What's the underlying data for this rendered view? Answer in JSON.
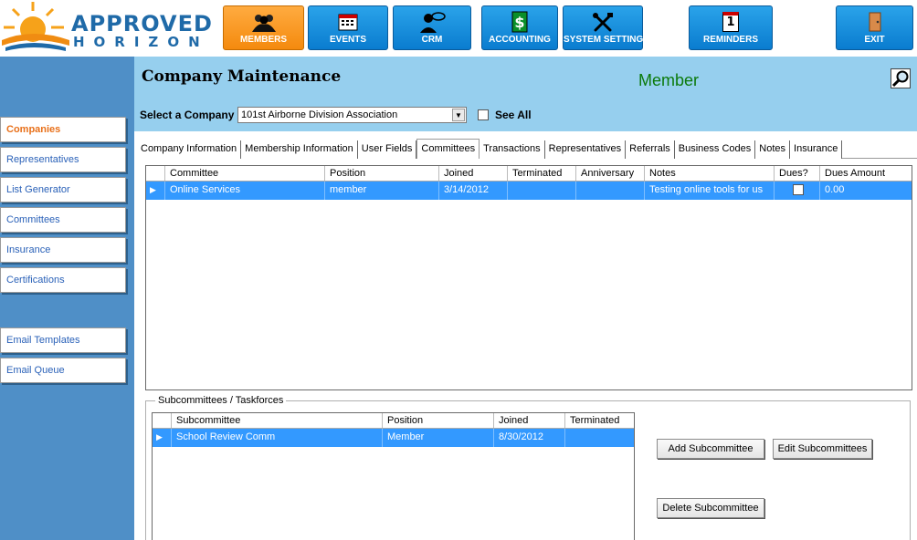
{
  "logo": {
    "line1": "APPROVED",
    "line2": "HORIZON"
  },
  "nav": {
    "members": "MEMBERS",
    "events": "EVENTS",
    "crm": "CRM",
    "accounting": "ACCOUNTING",
    "system_settings": "SYSTEM SETTINGS",
    "reminders": "REMINDERS",
    "reminders_count": "1",
    "exit": "EXIT"
  },
  "sidebar": {
    "items": [
      {
        "label": "Companies"
      },
      {
        "label": "Representatives"
      },
      {
        "label": "List Generator"
      },
      {
        "label": "Committees"
      },
      {
        "label": "Insurance"
      },
      {
        "label": "Certifications"
      },
      {
        "label": "Email Templates"
      },
      {
        "label": "Email Queue"
      }
    ]
  },
  "header": {
    "title": "Company Maintenance",
    "member_label": "Member",
    "select_label": "Select a Company",
    "selected_company": "101st Airborne Division Association",
    "see_all_label": "See All"
  },
  "tabs": [
    {
      "label": "Company Information"
    },
    {
      "label": "Membership Information"
    },
    {
      "label": "User Fields"
    },
    {
      "label": "Committees"
    },
    {
      "label": "Transactions"
    },
    {
      "label": "Representatives"
    },
    {
      "label": "Referrals"
    },
    {
      "label": "Business Codes"
    },
    {
      "label": "Notes"
    },
    {
      "label": "Insurance"
    }
  ],
  "committees": {
    "columns": [
      "Committee",
      "Position",
      "Joined",
      "Terminated",
      "Anniversary",
      "Notes",
      "Dues?",
      "Dues Amount"
    ],
    "rows": [
      {
        "committee": "Online Services",
        "position": "member",
        "joined": "3/14/2012",
        "terminated": "",
        "anniversary": "",
        "notes": "Testing online tools for us",
        "dues_amount": "0.00"
      }
    ]
  },
  "subcommittees": {
    "group_label": "Subcommittees / Taskforces",
    "columns": [
      "Subcommittee",
      "Position",
      "Joined",
      "Terminated"
    ],
    "rows": [
      {
        "subcommittee": "School Review Comm",
        "position": "Member",
        "joined": "8/30/2012",
        "terminated": ""
      }
    ],
    "add_button": "Add Subcommittee",
    "edit_button": "Edit Subcommittees",
    "delete_button": "Delete Subcommittee"
  },
  "colors": {
    "nav_blue": "#0a7ccf",
    "nav_active": "#f48a0e",
    "sidebar_bg": "#4f8fc7",
    "header_bg": "#96cfee",
    "selection": "#3399ff",
    "member_green": "#0b7a0b"
  }
}
